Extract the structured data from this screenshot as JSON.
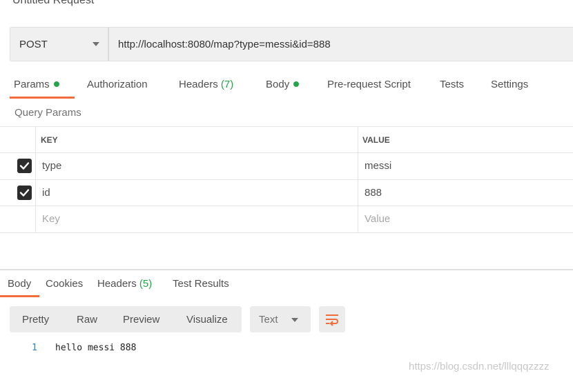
{
  "request": {
    "title": "Untitled Request",
    "method": "POST",
    "url": "http://localhost:8080/map?type=messi&id=888"
  },
  "request_tabs": [
    {
      "label": "Params",
      "dot": true,
      "active": true
    },
    {
      "label": "Authorization"
    },
    {
      "label": "Headers",
      "count": "(7)"
    },
    {
      "label": "Body",
      "dot": true
    },
    {
      "label": "Pre-request Script"
    },
    {
      "label": "Tests"
    },
    {
      "label": "Settings"
    }
  ],
  "query_params": {
    "title": "Query Params",
    "headers": {
      "key": "KEY",
      "value": "VALUE"
    },
    "rows": [
      {
        "checked": true,
        "key": "type",
        "value": "messi"
      },
      {
        "checked": true,
        "key": "id",
        "value": "888"
      }
    ],
    "placeholder": {
      "key": "Key",
      "value": "Value"
    }
  },
  "response_tabs": [
    {
      "label": "Body",
      "active": true
    },
    {
      "label": "Cookies"
    },
    {
      "label": "Headers",
      "count": "(5)"
    },
    {
      "label": "Test Results"
    }
  ],
  "view_modes": [
    "Pretty",
    "Raw",
    "Preview",
    "Visualize"
  ],
  "format": "Text",
  "response_body": {
    "line_number": "1",
    "content": "hello messi 888"
  },
  "watermark": "https://blog.csdn.net/lllqqqzzzz",
  "colors": {
    "accent": "#f26b3a",
    "green": "#26a44a",
    "check": "#2c2c2c"
  }
}
